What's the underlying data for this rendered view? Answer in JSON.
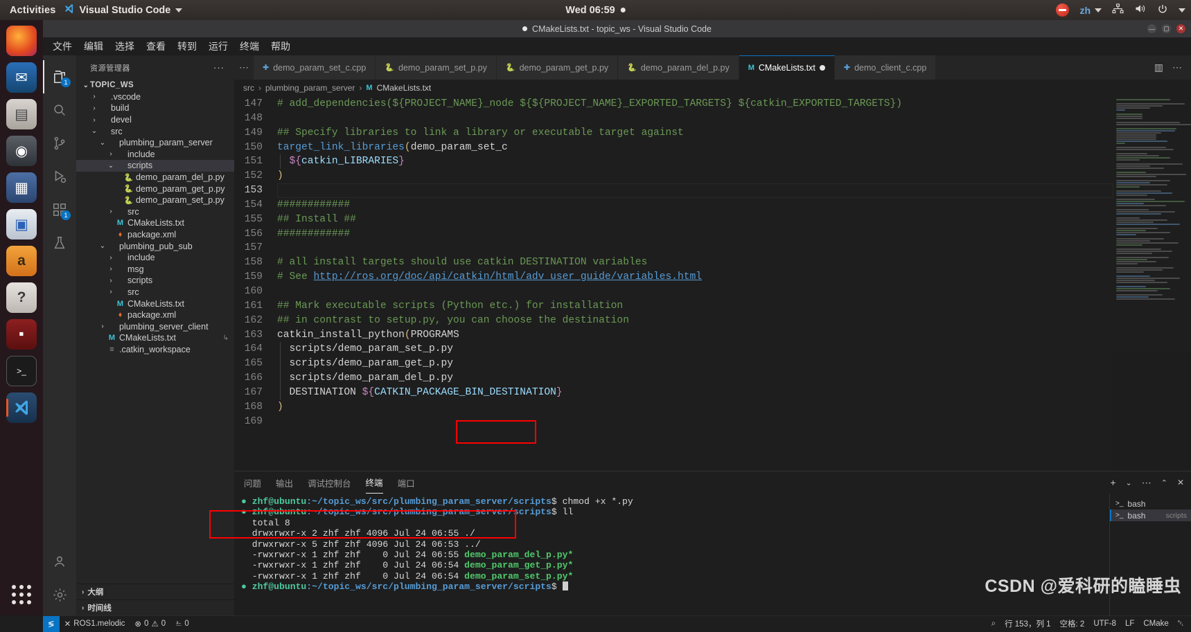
{
  "desktop": {
    "activities": "Activities",
    "app_menu": "Visual Studio Code",
    "clock": "Wed 06:59",
    "language": "zh",
    "dock_items": [
      {
        "name": "firefox",
        "glyph": "●"
      },
      {
        "name": "thunderbird",
        "glyph": "✉"
      },
      {
        "name": "files",
        "glyph": "▤"
      },
      {
        "name": "rhythmbox",
        "glyph": "◉"
      },
      {
        "name": "ubuntu-software",
        "glyph": "▦"
      },
      {
        "name": "libreoffice-writer",
        "glyph": "▣"
      },
      {
        "name": "amazon",
        "glyph": "a"
      },
      {
        "name": "help",
        "glyph": "?"
      },
      {
        "name": "terminator",
        "glyph": "■"
      },
      {
        "name": "terminal",
        "glyph": "⬛"
      },
      {
        "name": "vscode",
        "glyph": "⮞"
      }
    ]
  },
  "window": {
    "title": "CMakeLists.txt - topic_ws - Visual Studio Code",
    "menu": [
      "文件",
      "编辑",
      "选择",
      "查看",
      "转到",
      "运行",
      "终端",
      "帮助"
    ]
  },
  "sidebar": {
    "header": "资源管理器",
    "header_more": "···",
    "root": "TOPIC_WS",
    "items": [
      {
        "label": ".vscode",
        "depth": 1,
        "twisty": "›",
        "icon": "",
        "kind": "folder"
      },
      {
        "label": "build",
        "depth": 1,
        "twisty": "›",
        "icon": "",
        "kind": "folder"
      },
      {
        "label": "devel",
        "depth": 1,
        "twisty": "›",
        "icon": "",
        "kind": "folder"
      },
      {
        "label": "src",
        "depth": 1,
        "twisty": "⌄",
        "icon": "",
        "kind": "folder"
      },
      {
        "label": "plumbing_param_server",
        "depth": 2,
        "twisty": "⌄",
        "icon": "",
        "kind": "folder"
      },
      {
        "label": "include",
        "depth": 3,
        "twisty": "›",
        "icon": "",
        "kind": "folder"
      },
      {
        "label": "scripts",
        "depth": 3,
        "twisty": "⌄",
        "icon": "",
        "kind": "folder",
        "selected": true
      },
      {
        "label": "demo_param_del_p.py",
        "depth": 4,
        "twisty": "",
        "icon": "py",
        "kind": "file"
      },
      {
        "label": "demo_param_get_p.py",
        "depth": 4,
        "twisty": "",
        "icon": "py",
        "kind": "file"
      },
      {
        "label": "demo_param_set_p.py",
        "depth": 4,
        "twisty": "",
        "icon": "py",
        "kind": "file"
      },
      {
        "label": "src",
        "depth": 3,
        "twisty": "›",
        "icon": "",
        "kind": "folder"
      },
      {
        "label": "CMakeLists.txt",
        "depth": 3,
        "twisty": "",
        "icon": "cmake",
        "kind": "file"
      },
      {
        "label": "package.xml",
        "depth": 3,
        "twisty": "",
        "icon": "xml",
        "kind": "file"
      },
      {
        "label": "plumbing_pub_sub",
        "depth": 2,
        "twisty": "⌄",
        "icon": "",
        "kind": "folder"
      },
      {
        "label": "include",
        "depth": 3,
        "twisty": "›",
        "icon": "",
        "kind": "folder"
      },
      {
        "label": "msg",
        "depth": 3,
        "twisty": "›",
        "icon": "",
        "kind": "folder"
      },
      {
        "label": "scripts",
        "depth": 3,
        "twisty": "›",
        "icon": "",
        "kind": "folder"
      },
      {
        "label": "src",
        "depth": 3,
        "twisty": "›",
        "icon": "",
        "kind": "folder"
      },
      {
        "label": "CMakeLists.txt",
        "depth": 3,
        "twisty": "",
        "icon": "cmake",
        "kind": "file"
      },
      {
        "label": "package.xml",
        "depth": 3,
        "twisty": "",
        "icon": "xml",
        "kind": "file"
      },
      {
        "label": "plumbing_server_client",
        "depth": 2,
        "twisty": "›",
        "icon": "",
        "kind": "folder"
      },
      {
        "label": "CMakeLists.txt",
        "depth": 2,
        "twisty": "",
        "icon": "cmake",
        "kind": "file",
        "trailing": "↳"
      },
      {
        "label": ".catkin_workspace",
        "depth": 2,
        "twisty": "",
        "icon": "ws",
        "kind": "file"
      }
    ],
    "sections": [
      {
        "label": "大纲",
        "twisty": "›"
      },
      {
        "label": "时间线",
        "twisty": "›"
      }
    ]
  },
  "activity_bar": {
    "items": [
      {
        "name": "explorer",
        "glyph": "❐",
        "badge": "1",
        "active": true
      },
      {
        "name": "search",
        "glyph": "⌕",
        "badge": "",
        "active": false
      },
      {
        "name": "source-control",
        "glyph": "⑂",
        "badge": "",
        "active": false
      },
      {
        "name": "run-and-debug",
        "glyph": "▷",
        "badge": "",
        "active": false
      },
      {
        "name": "extensions",
        "glyph": "⌸",
        "badge": "1",
        "active": false
      },
      {
        "name": "testing",
        "glyph": "⚗",
        "badge": "",
        "active": false
      }
    ],
    "bottom": [
      {
        "name": "accounts",
        "glyph": "○"
      },
      {
        "name": "manage-settings",
        "glyph": "⚙"
      }
    ]
  },
  "tabs": [
    {
      "label": "demo_param_set_c.cpp",
      "icon": "cpp",
      "active": false,
      "dirty": false
    },
    {
      "label": "demo_param_set_p.py",
      "icon": "py",
      "active": false,
      "dirty": false
    },
    {
      "label": "demo_param_get_p.py",
      "icon": "py",
      "active": false,
      "dirty": false
    },
    {
      "label": "demo_param_del_p.py",
      "icon": "py",
      "active": false,
      "dirty": false
    },
    {
      "label": "CMakeLists.txt",
      "icon": "cmake",
      "active": true,
      "dirty": true
    },
    {
      "label": "demo_client_c.cpp",
      "icon": "cpp",
      "active": false,
      "dirty": false
    }
  ],
  "editor_actions": [
    "❐",
    "⋯"
  ],
  "breadcrumb": [
    "src",
    "plumbing_param_server",
    "CMakeLists.txt"
  ],
  "code": {
    "first_visible_line": 147,
    "current_line": 153,
    "lines": [
      {
        "n": 147,
        "tokens": [
          {
            "t": "# add_dependencies(${PROJECT_NAME}_node ${${PROJECT_NAME}_EXPORTED_TARGETS} ${catkin_EXPORTED_TARGETS})",
            "c": "cmt"
          }
        ]
      },
      {
        "n": 148,
        "tokens": []
      },
      {
        "n": 149,
        "tokens": [
          {
            "t": "## Specify libraries to link a library or executable target against",
            "c": "cmt"
          }
        ]
      },
      {
        "n": 150,
        "tokens": [
          {
            "t": "target_link_libraries",
            "c": "fn"
          },
          {
            "t": "(",
            "c": "par"
          },
          {
            "t": "demo_param_set_c",
            "c": "pln"
          }
        ]
      },
      {
        "n": 151,
        "tokens": [
          {
            "t": "  ",
            "c": "pln"
          },
          {
            "t": "${",
            "c": "brc"
          },
          {
            "t": "catkin_LIBRARIES",
            "c": "var"
          },
          {
            "t": "}",
            "c": "brc"
          }
        ]
      },
      {
        "n": 152,
        "tokens": [
          {
            "t": ")",
            "c": "par"
          }
        ]
      },
      {
        "n": 153,
        "tokens": []
      },
      {
        "n": 154,
        "tokens": [
          {
            "t": "############",
            "c": "cmt"
          }
        ]
      },
      {
        "n": 155,
        "tokens": [
          {
            "t": "## Install ##",
            "c": "cmt"
          }
        ]
      },
      {
        "n": 156,
        "tokens": [
          {
            "t": "############",
            "c": "cmt"
          }
        ]
      },
      {
        "n": 157,
        "tokens": []
      },
      {
        "n": 158,
        "tokens": [
          {
            "t": "# all install targets should use catkin DESTINATION variables",
            "c": "cmt"
          }
        ]
      },
      {
        "n": 159,
        "tokens": [
          {
            "t": "# See ",
            "c": "cmt"
          },
          {
            "t": "http://ros.org/doc/api/catkin/html/adv_user_guide/variables.html",
            "c": "lnk"
          }
        ]
      },
      {
        "n": 160,
        "tokens": []
      },
      {
        "n": 161,
        "tokens": [
          {
            "t": "## Mark executable scripts (Python etc.) for installation",
            "c": "cmt"
          }
        ]
      },
      {
        "n": 162,
        "tokens": [
          {
            "t": "## in contrast to setup.py, you can choose the destination",
            "c": "cmt"
          }
        ]
      },
      {
        "n": 163,
        "tokens": [
          {
            "t": "catkin_install_python",
            "c": "pln"
          },
          {
            "t": "(",
            "c": "par"
          },
          {
            "t": "PROGRAMS",
            "c": "pln"
          }
        ]
      },
      {
        "n": 164,
        "tokens": [
          {
            "t": "  scripts/demo_param_set_p.py",
            "c": "pln"
          }
        ]
      },
      {
        "n": 165,
        "tokens": [
          {
            "t": "  scripts/demo_param_get_p.py",
            "c": "pln"
          }
        ]
      },
      {
        "n": 166,
        "tokens": [
          {
            "t": "  scripts/demo_param_del_p.py",
            "c": "pln"
          }
        ]
      },
      {
        "n": 167,
        "tokens": [
          {
            "t": "  DESTINATION ",
            "c": "pln"
          },
          {
            "t": "${",
            "c": "brc"
          },
          {
            "t": "CATKIN_PACKAGE_BIN_DESTINATION",
            "c": "var"
          },
          {
            "t": "}",
            "c": "brc"
          }
        ]
      },
      {
        "n": 168,
        "tokens": [
          {
            "t": ")",
            "c": "par"
          }
        ]
      },
      {
        "n": 169,
        "tokens": []
      }
    ]
  },
  "panel": {
    "tabs": [
      "问题",
      "输出",
      "调试控制台",
      "终端",
      "端口"
    ],
    "active_tab": "终端",
    "actions": [
      "+",
      "⌄",
      "⋯",
      "⌃",
      "✕"
    ],
    "terminal_list": [
      {
        "label": "bash",
        "sub": "",
        "active": false
      },
      {
        "label": "bash",
        "sub": "scripts",
        "active": true
      }
    ],
    "terminal_lines": [
      {
        "kind": "prompt",
        "user": "zhf@ubuntu",
        "path": ":~/topic_ws/src/plumbing_param_server/scripts",
        "sym": "$ ",
        "cmd": "chmod +x *.py"
      },
      {
        "kind": "prompt",
        "user": "zhf@ubuntu",
        "path": ":~/topic_ws/src/plumbing_param_server/scripts",
        "sym": "$ ",
        "cmd": "ll"
      },
      {
        "kind": "plain",
        "text": "total 8"
      },
      {
        "kind": "plain",
        "text": "drwxrwxr-x 2 zhf zhf 4096 Jul 24 06:55 ./"
      },
      {
        "kind": "plain",
        "text": "drwxrwxr-x 5 zhf zhf 4096 Jul 24 06:53 ../"
      },
      {
        "kind": "file",
        "perm": "-rwxrwxr-x 1 zhf zhf    0 Jul 24 06:55 ",
        "name": "demo_param_del_p.py*"
      },
      {
        "kind": "file",
        "perm": "-rwxrwxr-x 1 zhf zhf    0 Jul 24 06:54 ",
        "name": "demo_param_get_p.py*"
      },
      {
        "kind": "file",
        "perm": "-rwxrwxr-x 1 zhf zhf    0 Jul 24 06:54 ",
        "name": "demo_param_set_p.py*"
      },
      {
        "kind": "prompt",
        "user": "zhf@ubuntu",
        "path": ":~/topic_ws/src/plumbing_param_server/scripts",
        "sym": "$ ",
        "cmd": ""
      }
    ]
  },
  "status_bar": {
    "remote_glyph": "≶",
    "ros": "ROS1.melodic",
    "errors": "0",
    "warnings": "0",
    "ports": "0",
    "position": "行 153，列 1",
    "spaces": "空格: 2",
    "encoding": "UTF-8",
    "eol": "LF",
    "language": "CMake",
    "bell": "␇"
  },
  "watermark": "CSDN @爱科研的瞌睡虫",
  "colors": {
    "accent": "#0a74c4",
    "ubuntu_orange": "#e95420",
    "highlight_red": "#ff0000",
    "terminal_green": "#4fc96b"
  }
}
